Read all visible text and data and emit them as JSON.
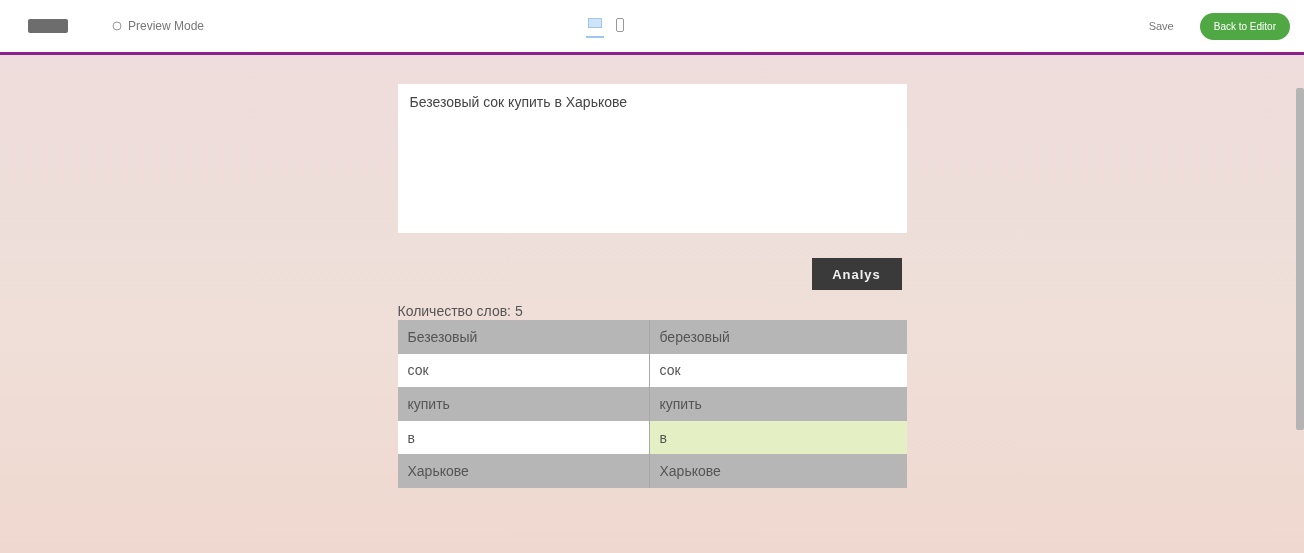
{
  "top_bar": {
    "mode_label": "Preview Mode",
    "devices": [
      {
        "kind": "desktop",
        "selected": true
      },
      {
        "kind": "mobile",
        "selected": false
      }
    ],
    "save": "Save",
    "back": "Back to Editor"
  },
  "text_input": {
    "value": "Безезовый сок купить в Харькове"
  },
  "analyze_button": "Analys",
  "word_count": "Количество слов: 5",
  "table": {
    "rows": [
      {
        "cells": [
          {
            "text": "Безезовый",
            "highlighted": false
          },
          {
            "text": "березовый",
            "highlighted": false
          }
        ]
      },
      {
        "cells": [
          {
            "text": "сок",
            "highlighted": false
          },
          {
            "text": "сок",
            "highlighted": false
          }
        ]
      },
      {
        "cells": [
          {
            "text": "купить",
            "highlighted": false
          },
          {
            "text": "купить",
            "highlighted": false
          }
        ]
      },
      {
        "cells": [
          {
            "text": "в",
            "highlighted": false
          },
          {
            "text": "в",
            "highlighted": true
          }
        ]
      },
      {
        "cells": [
          {
            "text": "Харькове",
            "highlighted": false
          },
          {
            "text": "Харькове",
            "highlighted": false
          }
        ]
      }
    ]
  }
}
